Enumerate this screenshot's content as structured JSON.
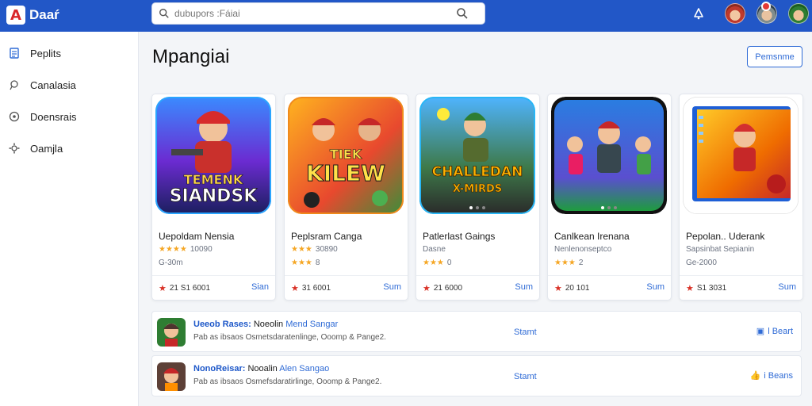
{
  "app": {
    "brand_name": "Daaŕ",
    "brand_letter": "A"
  },
  "search": {
    "placeholder": "dubupors :Fáiai",
    "value": ""
  },
  "colors": {
    "topbar": "#2257c7",
    "accent": "#2f6bd6",
    "star": "#f5a623",
    "heart": "#d93025"
  },
  "sidebar": {
    "items": [
      {
        "label": "Peplits",
        "icon": "document-icon"
      },
      {
        "label": "Canalasia",
        "icon": "pin-icon"
      },
      {
        "label": "Doensrais",
        "icon": "globe-icon"
      },
      {
        "label": "Oamjla",
        "icon": "gear-icon"
      }
    ]
  },
  "main": {
    "title": "Mpangiai",
    "primary_button": "Pemsnme"
  },
  "cards": [
    {
      "name": "Uepoldam Nensia",
      "stars": "★★★★",
      "rating_count": "10090",
      "meta2": "G-30m",
      "foot_count": "21 S1 6001",
      "action": "Sian",
      "art_text": [
        "TEMENK",
        "SIANDSK"
      ]
    },
    {
      "name": "Peplsram Canga",
      "stars": "★★★",
      "rating_count": "30890",
      "meta2": "",
      "foot_count": "31 6001",
      "action": "Sum",
      "art_text": [
        "TIEK",
        "KILEW"
      ]
    },
    {
      "name": "Patlerlast Gaings",
      "stars": "★★★",
      "rating_count": "0",
      "meta2": "Dasne",
      "foot_count": "21 6000",
      "action": "Sum",
      "art_text": [
        "CHALLEDAN",
        "X-MIRDS"
      ]
    },
    {
      "name": "Canlkean Irenana",
      "stars": "★★★",
      "rating_count": "2",
      "meta2": "Nenlenonseptco",
      "foot_count": "20 101",
      "action": "Sum",
      "art_text": []
    },
    {
      "name": "Pepolan.. Uderank",
      "stars": "",
      "rating_count": "",
      "meta2": "Sapsinbat  Sepianin",
      "meta3": "Ge-2000",
      "foot_count": "S1 3031",
      "action": "Sum",
      "art_text": []
    }
  ],
  "list": [
    {
      "title_a": "Ueeob Rases:",
      "title_b": "Noeolin",
      "title_c": "Mend Sangar",
      "subtitle": "Pab  as  ibsaos Osmetsdaratenlinge,  Ooomp &  Pange2.",
      "link": "Stamt",
      "button": "l Beart"
    },
    {
      "title_a": "NonoReisar:",
      "title_b": "Nooalin",
      "title_c": "Alen Sangao",
      "subtitle": "Pab  as  ibsaos Osmefsdaratirlinge,  Ooomp &  Pange2.",
      "link": "Stamt",
      "button": "i Beans"
    }
  ]
}
